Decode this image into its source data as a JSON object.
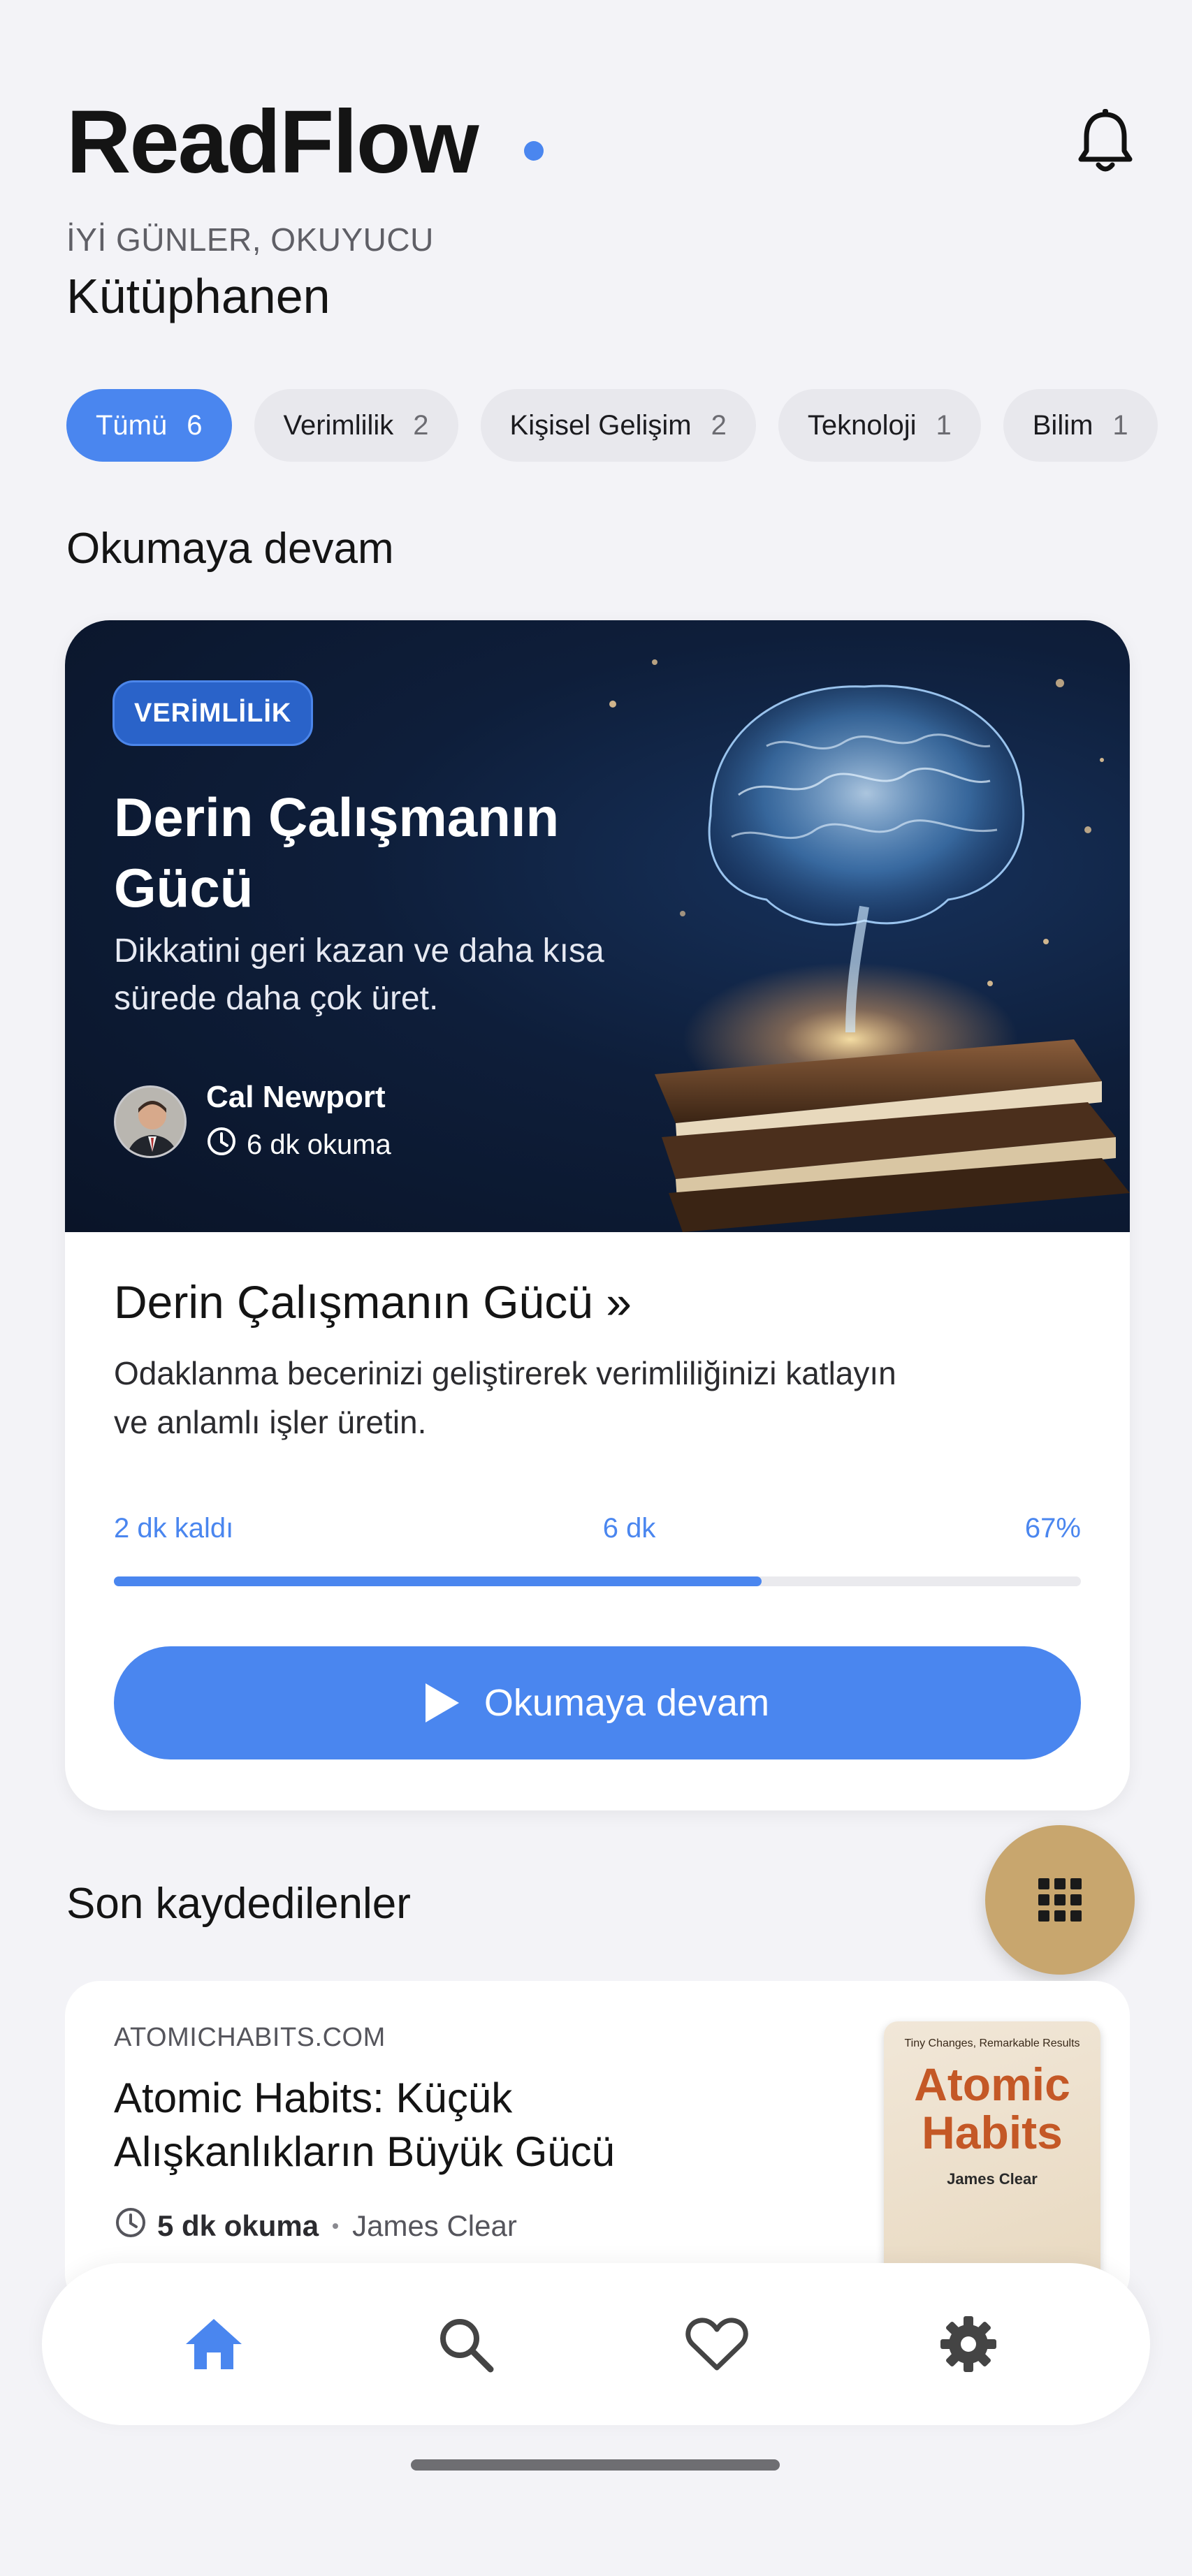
{
  "app": {
    "title": "ReadFlow",
    "greeting": "İYİ GÜNLER, OKUYUCU",
    "subtitle": "Kütüphanen"
  },
  "icons": {
    "notifications": "bell-icon",
    "menu": "grid-icon",
    "home": "home-icon",
    "search": "search-icon",
    "favorites": "heart-icon",
    "settings": "gear-icon"
  },
  "colors": {
    "accent": "#4a86ef",
    "fab": "#c8a66e",
    "background": "#f3f3f7"
  },
  "filters": [
    {
      "label": "Tümü",
      "count": "6",
      "active": true
    },
    {
      "label": "Verimlilik",
      "count": "2",
      "active": false
    },
    {
      "label": "Kişisel Gelişim",
      "count": "2",
      "active": false
    },
    {
      "label": "Teknoloji",
      "count": "1",
      "active": false
    },
    {
      "label": "Bilim",
      "count": "1",
      "active": false
    }
  ],
  "continue_reading": {
    "section_title": "Okumaya devam",
    "tag": "VERİMLİLİK",
    "hero_title": "Derin Çalışmanın Gücü",
    "hero_description": "Dikkatini geri kazan ve daha kısa sürede daha çok üret.",
    "author": "Cal Newport",
    "read_time": "6 dk okuma",
    "title": "Derin Çalışmanın Gücü »",
    "description": "Odaklanma becerinizi geliştirerek verimliliğinizi katlayın ve anlamlı işler üretin.",
    "remaining": "2 dk kaldı",
    "total": "6 dk",
    "percent_label": "67%",
    "progress": 0.67,
    "button_label": "Okumaya devam"
  },
  "recently_saved": {
    "section_title": "Son kaydedilenler",
    "items": [
      {
        "source": "ATOMICHABITS.COM",
        "title": "Atomic Habits: Küçük Alışkanlıkların Büyük Gücü",
        "read_time": "5 dk okuma",
        "author": "James Clear",
        "cover": {
          "tagline": "Tiny Changes, Remarkable Results",
          "title_line1": "Atomic",
          "title_line2": "Habits",
          "author": "James Clear"
        }
      }
    ]
  }
}
